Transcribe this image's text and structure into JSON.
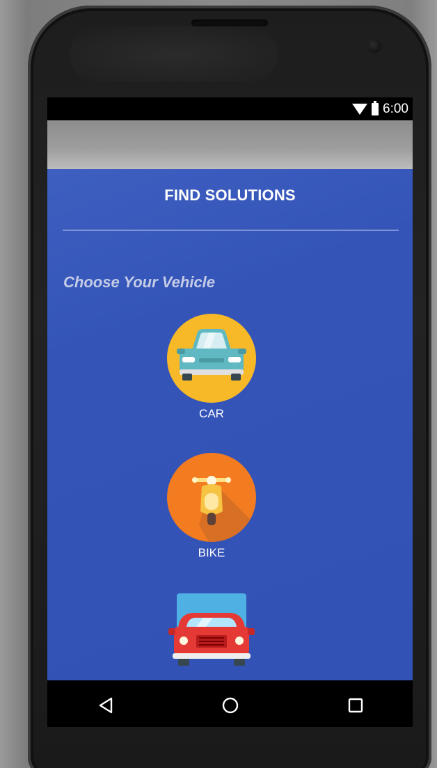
{
  "status_bar": {
    "time": "6:00",
    "icons": [
      "wifi-icon",
      "battery-icon"
    ]
  },
  "screen": {
    "title": "FIND SOLUTIONS",
    "subtitle": "Choose Your Vehicle"
  },
  "vehicles": [
    {
      "label": "CAR",
      "icon": "car-icon"
    },
    {
      "label": "BIKE",
      "icon": "scooter-icon"
    },
    {
      "label": "",
      "icon": "truck-icon"
    }
  ],
  "nav_bar": {
    "icons": [
      "back-icon",
      "home-icon",
      "recents-icon"
    ]
  },
  "colors": {
    "content_background": "#3352b6",
    "car_circle": "#f7b928",
    "bike_circle": "#f47c20",
    "truck_body": "#e53935",
    "truck_cargo": "#4fb0e3"
  }
}
